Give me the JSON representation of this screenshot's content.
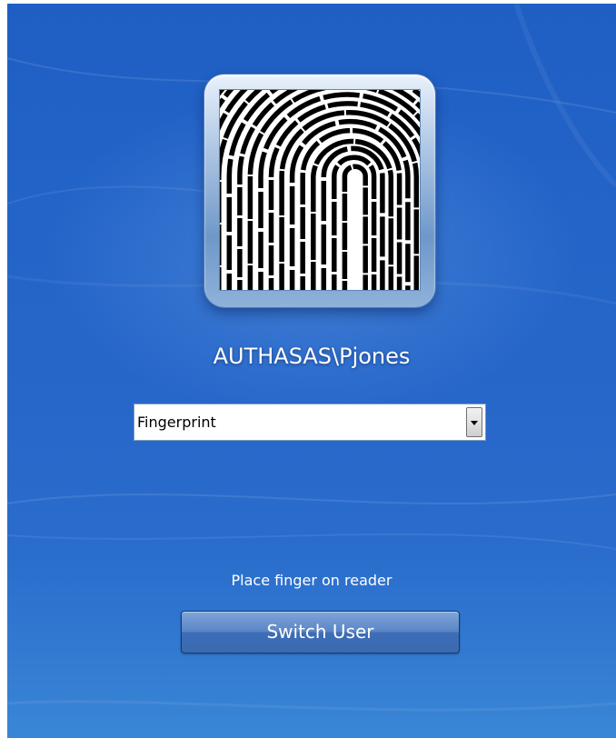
{
  "user": {
    "avatar_icon": "fingerprint-icon",
    "name": "AUTHASAS\\Pjones"
  },
  "method_select": {
    "selected": "Fingerprint",
    "dropdown_icon": "chevron-down-icon"
  },
  "status": {
    "prompt": "Place finger on reader"
  },
  "actions": {
    "switch_user_label": "Switch User"
  },
  "colors": {
    "background": "#2364c8",
    "text": "#ffffff",
    "button": "#4a78bd"
  }
}
